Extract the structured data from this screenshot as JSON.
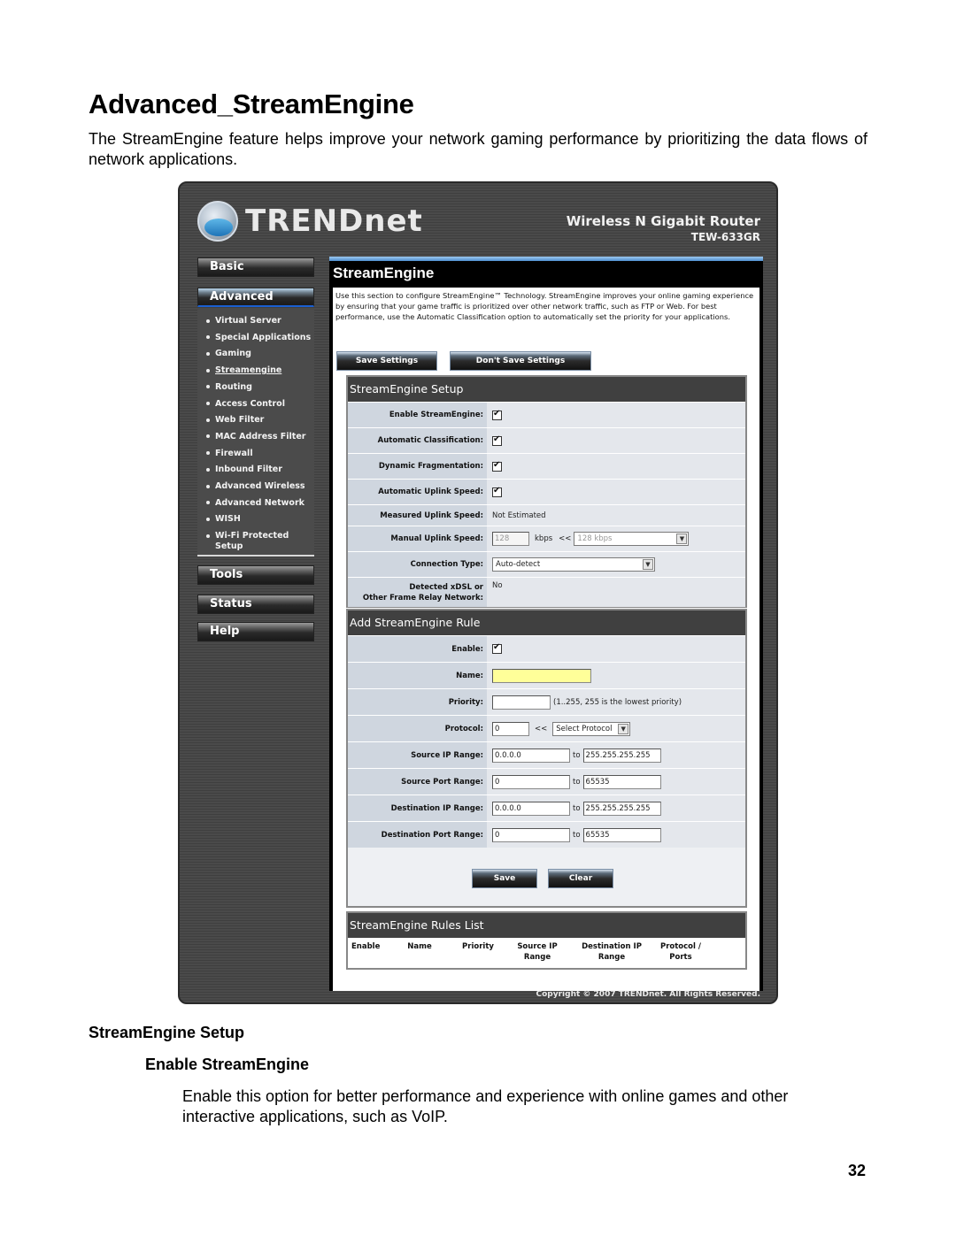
{
  "document": {
    "title": "Advanced_StreamEngine",
    "intro": "The StreamEngine feature helps improve your network gaming performance by prioritizing the data flows of network applications.",
    "section_heading": "StreamEngine Setup",
    "subsection_heading": "Enable StreamEngine",
    "subsection_text": "Enable this option for better performance and experience with online games and other interactive applications, such as VoIP.",
    "page_number": "32"
  },
  "router_ui": {
    "brand": "TRENDnet",
    "product_name": "Wireless N Gigabit Router",
    "product_model": "TEW-633GR",
    "nav": {
      "basic": "Basic",
      "advanced": "Advanced",
      "tools": "Tools",
      "status": "Status",
      "help": "Help",
      "advanced_items": [
        {
          "label": "Virtual Server"
        },
        {
          "label": "Special Applications"
        },
        {
          "label": "Gaming"
        },
        {
          "label": "Streamengine",
          "current": true
        },
        {
          "label": "Routing"
        },
        {
          "label": "Access Control"
        },
        {
          "label": "Web Filter"
        },
        {
          "label": "MAC Address Filter"
        },
        {
          "label": "Firewall"
        },
        {
          "label": "Inbound Filter"
        },
        {
          "label": "Advanced Wireless"
        },
        {
          "label": "Advanced Network"
        },
        {
          "label": "WISH"
        },
        {
          "label": "Wi-Fi Protected Setup"
        }
      ]
    },
    "page_title": "StreamEngine",
    "page_intro": "Use this section to configure StreamEngine™ Technology. StreamEngine improves your online gaming experience by ensuring that your game traffic is prioritized over other network traffic, such as FTP or Web. For best performance, use the Automatic Classification option to automatically set the priority for your applications.",
    "save_settings_label": "Save Settings",
    "dont_save_settings_label": "Don't Save Settings",
    "setup": {
      "header": "StreamEngine Setup",
      "enable_label": "Enable StreamEngine:",
      "enable_checked": true,
      "auto_class_label": "Automatic Classification:",
      "auto_class_checked": true,
      "dyn_frag_label": "Dynamic Fragmentation:",
      "dyn_frag_checked": true,
      "auto_uplink_label": "Automatic Uplink Speed:",
      "auto_uplink_checked": true,
      "measured_label": "Measured Uplink Speed:",
      "measured_value": "Not Estimated",
      "manual_label": "Manual Uplink Speed:",
      "manual_value": "128",
      "manual_unit": "kbps",
      "manual_arrow": "<<",
      "manual_select": "128 kbps",
      "conn_type_label": "Connection Type:",
      "conn_type_value": "Auto-detect",
      "xdsl_label_1": "Detected xDSL or",
      "xdsl_label_2": "Other Frame Relay Network:",
      "xdsl_value": "No"
    },
    "add_rule": {
      "header": "Add StreamEngine Rule",
      "enable_label": "Enable:",
      "enable_checked": true,
      "name_label": "Name:",
      "name_value": "",
      "priority_label": "Priority:",
      "priority_value": "",
      "priority_hint": "(1..255, 255 is the lowest priority)",
      "protocol_label": "Protocol:",
      "protocol_value": "0",
      "protocol_arrow": "<<",
      "protocol_select": "Select Protocol",
      "src_ip_label": "Source IP Range:",
      "src_ip_from": "0.0.0.0",
      "src_ip_to": "255.255.255.255",
      "src_port_label": "Source Port Range:",
      "src_port_from": "0",
      "src_port_to": "65535",
      "dst_ip_label": "Destination IP Range:",
      "dst_ip_from": "0.0.0.0",
      "dst_ip_to": "255.255.255.255",
      "dst_port_label": "Destination Port Range:",
      "dst_port_from": "0",
      "dst_port_to": "65535",
      "to_label": "to",
      "save_label": "Save",
      "clear_label": "Clear"
    },
    "rules_list": {
      "header": "StreamEngine Rules List",
      "columns": [
        "Enable",
        "Name",
        "Priority",
        "Source IP Range",
        "Destination IP Range",
        "Protocol / Ports"
      ]
    },
    "copyright": "Copyright © 2007 TRENDnet. All Rights Reserved."
  }
}
